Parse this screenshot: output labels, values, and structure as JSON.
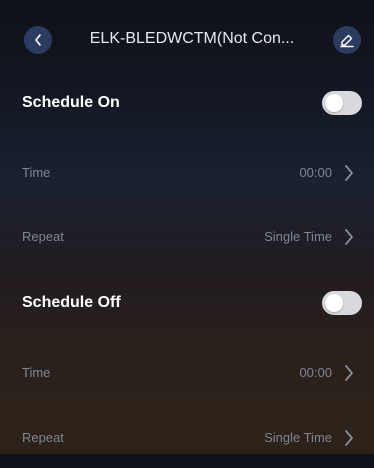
{
  "header": {
    "title": "ELK-BLEDWCTM(Not Con...",
    "back_icon": "chevron-left-icon",
    "edit_icon": "pencil-icon"
  },
  "schedule_on": {
    "label": "Schedule On",
    "enabled": false,
    "time_label": "Time",
    "time_value": "00:00",
    "repeat_label": "Repeat",
    "repeat_value": "Single Time"
  },
  "schedule_off": {
    "label": "Schedule Off",
    "enabled": false,
    "time_label": "Time",
    "time_value": "00:00",
    "repeat_label": "Repeat",
    "repeat_value": "Single Time"
  },
  "colors": {
    "header_button_bg": "#2b3c60",
    "toggle_off": "#d9dadf",
    "muted_text": "#7f8594"
  }
}
